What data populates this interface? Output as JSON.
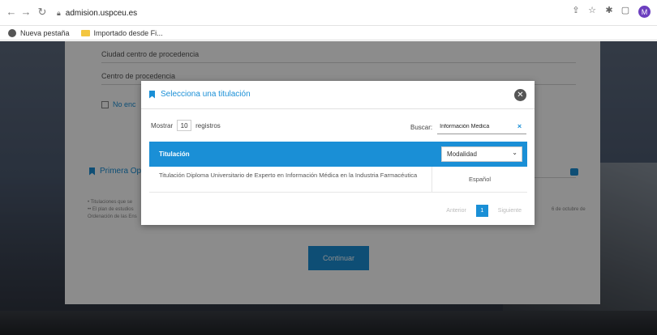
{
  "browser": {
    "url": "admision.uspceu.es",
    "avatar_letter": "M",
    "bookmarks": [
      {
        "label": "Nueva pestaña"
      },
      {
        "label": "Importado desde Fi..."
      }
    ]
  },
  "form": {
    "field1": "Ciudad centro de procedencia",
    "field2": "Centro de procedencia",
    "checkbox_label": "No enc",
    "section_title": "Primera Opc",
    "note1": "• Titulaciones que se",
    "note2": "•• El plan de estudios",
    "note3": "Ordenación de las Ens",
    "note_right": "6 de octubre de",
    "continue_label": "Continuar"
  },
  "modal": {
    "title": "Selecciona una titulación",
    "show_label": "Mostrar",
    "show_value": "10",
    "show_suffix": "registros",
    "search_label": "Buscar:",
    "search_value": "Información Medica",
    "table": {
      "col_title": "Titulación",
      "col_modality": "Modalidad",
      "rows": [
        {
          "title": "Titulación Diploma Universitario de Experto en Información Médica en la Industria Farmacéutica",
          "modality": "Español"
        }
      ]
    },
    "pager": {
      "prev": "Anterior",
      "current": "1",
      "next": "Siguiente"
    }
  },
  "colors": {
    "accent": "#1a8fd6"
  }
}
